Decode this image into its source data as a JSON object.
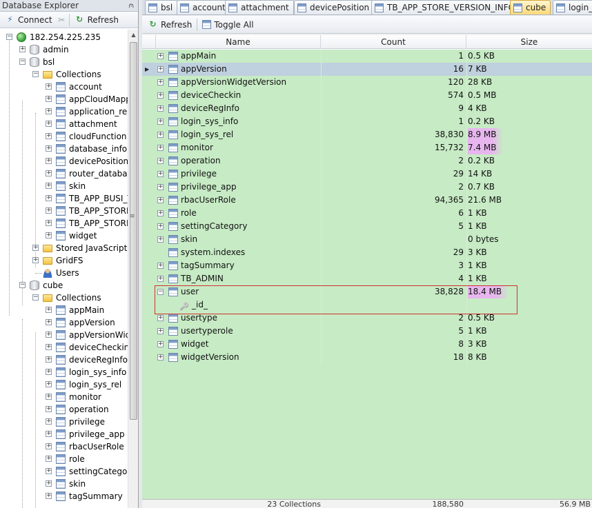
{
  "left_panel": {
    "title": "Database Explorer",
    "connect_label": "Connect",
    "refresh_label": "Refresh"
  },
  "tree": {
    "server": "182.254.225.235",
    "admin": "admin",
    "bsl": {
      "label": "bsl",
      "collections_label": "Collections",
      "collections": [
        "account",
        "appCloudMapp",
        "application_reg",
        "attachment",
        "cloudFunction",
        "database_info",
        "devicePosition",
        "router_database",
        "skin",
        "TB_APP_BUSI_T",
        "TB_APP_STORE",
        "TB_APP_STORE",
        "widget"
      ],
      "stored_js": "Stored JavaScript",
      "gridfs": "GridFS",
      "users": "Users"
    },
    "cube": {
      "label": "cube",
      "collections_label": "Collections",
      "collections": [
        "appMain",
        "appVersion",
        "appVersionWid",
        "deviceCheckin",
        "deviceRegInfo",
        "login_sys_info",
        "login_sys_rel",
        "monitor",
        "operation",
        "privilege",
        "privilege_app",
        "rbacUserRole",
        "role",
        "settingCategory",
        "skin",
        "tagSummary"
      ]
    }
  },
  "tabs": [
    "bsl",
    "account",
    "attachment",
    "devicePosition",
    "TB_APP_STORE_VERSION_INFO",
    "cube",
    "login_s"
  ],
  "active_tab": "cube",
  "toolbar": {
    "refresh_label": "Refresh",
    "toggle_label": "Toggle All"
  },
  "grid": {
    "columns": {
      "name": "Name",
      "count": "Count",
      "size": "Size"
    },
    "rows": [
      {
        "name": "appMain",
        "count": "1",
        "size": "0.5 KB"
      },
      {
        "name": "appVersion",
        "count": "16",
        "size": "7 KB",
        "selected": true
      },
      {
        "name": "appVersionWidgetVersion",
        "count": "120",
        "size": "28 KB"
      },
      {
        "name": "deviceCheckin",
        "count": "574",
        "size": "0.5 MB"
      },
      {
        "name": "deviceRegInfo",
        "count": "9",
        "size": "4 KB"
      },
      {
        "name": "login_sys_info",
        "count": "1",
        "size": "0.2 KB"
      },
      {
        "name": "login_sys_rel",
        "count": "38,830",
        "size": "8.9 MB",
        "highlight": true
      },
      {
        "name": "monitor",
        "count": "15,732",
        "size": "7.4 MB",
        "highlight": true
      },
      {
        "name": "operation",
        "count": "2",
        "size": "0.2 KB"
      },
      {
        "name": "privilege",
        "count": "29",
        "size": "14 KB"
      },
      {
        "name": "privilege_app",
        "count": "2",
        "size": "0.7 KB"
      },
      {
        "name": "rbacUserRole",
        "count": "94,365",
        "size": "21.6 MB"
      },
      {
        "name": "role",
        "count": "6",
        "size": "1 KB"
      },
      {
        "name": "settingCategory",
        "count": "5",
        "size": "1 KB"
      },
      {
        "name": "skin",
        "count": "",
        "size": "0 bytes"
      },
      {
        "name": "system.indexes",
        "count": "29",
        "size": "3 KB",
        "no_expander": true
      },
      {
        "name": "tagSummary",
        "count": "3",
        "size": "1 KB"
      },
      {
        "name": "TB_ADMIN",
        "count": "4",
        "size": "1 KB"
      },
      {
        "name": "user",
        "count": "38,828",
        "size": "18.4 MB",
        "highlight": true,
        "expanded": true
      },
      {
        "name": "_id_",
        "index": true
      },
      {
        "name": "usertype",
        "count": "2",
        "size": "0.5 KB"
      },
      {
        "name": "usertyperole",
        "count": "5",
        "size": "1 KB"
      },
      {
        "name": "widget",
        "count": "8",
        "size": "3 KB"
      },
      {
        "name": "widgetVersion",
        "count": "18",
        "size": "8 KB"
      }
    ],
    "footer": {
      "collections": "23 Collections",
      "count": "188,580",
      "size": "56.9 MB"
    }
  },
  "icons": {
    "pin": "pin-icon",
    "connect": "plug-icon",
    "disconnect": "unplug-icon",
    "refresh": "refresh-icon",
    "server": "server-icon",
    "database": "database-icon",
    "folder": "folder-icon",
    "collection": "table-icon",
    "index": "key-icon",
    "users": "user-icon"
  },
  "colors": {
    "grid_row": "#c7ebc5",
    "selected_row": "#bfd0de",
    "size_highlight": "#e7b6ee",
    "active_tab": "#fbd978",
    "red_box": "#d03030"
  }
}
